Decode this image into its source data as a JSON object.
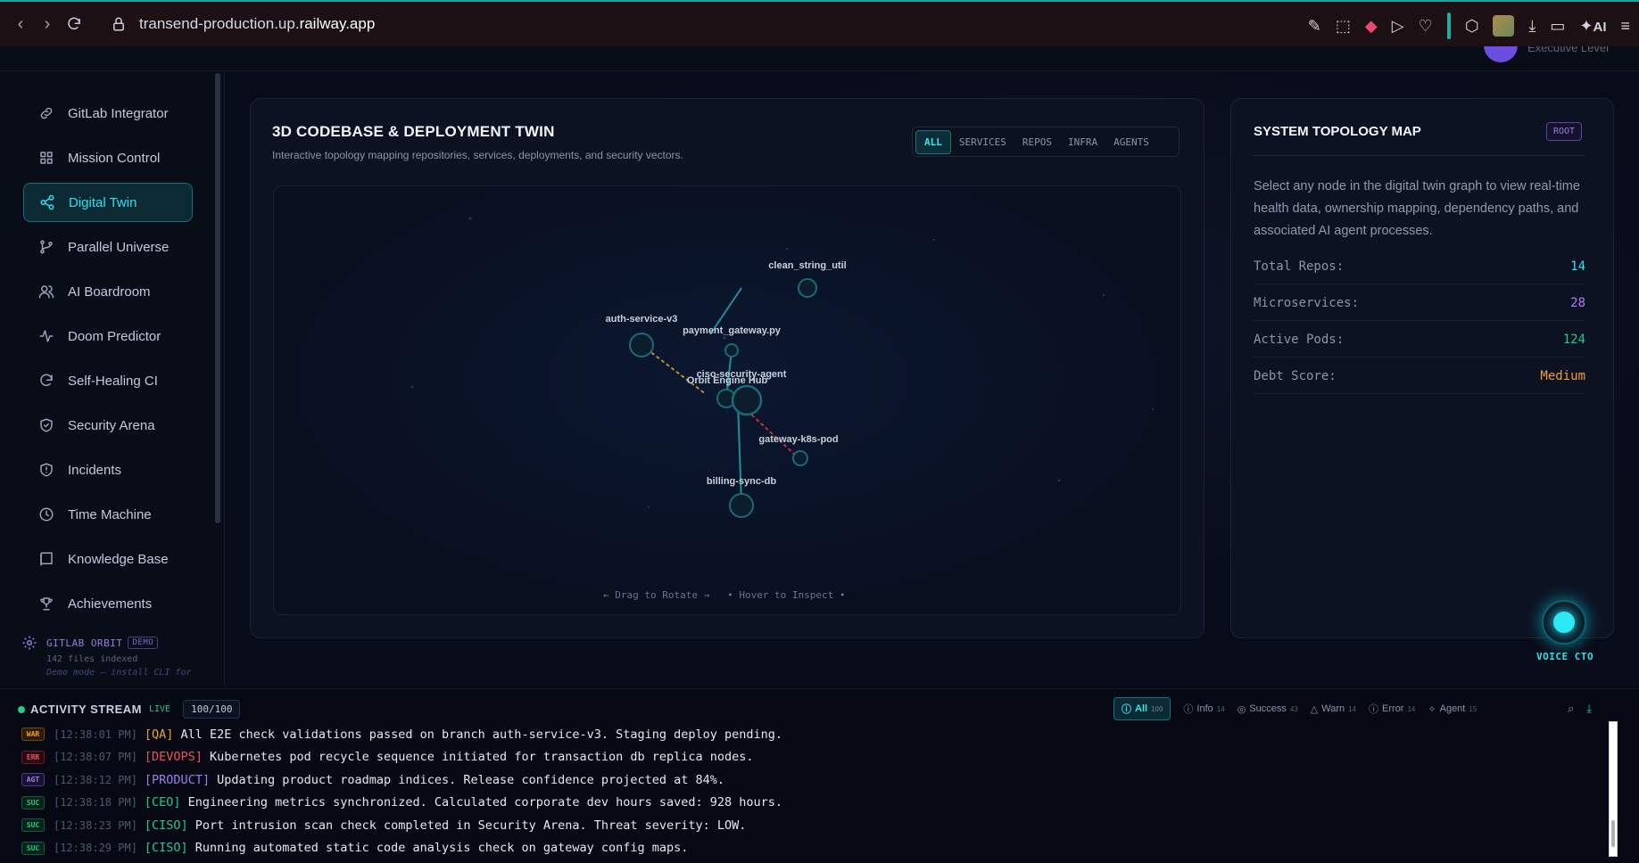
{
  "browser": {
    "url_host": "transend-production.up.",
    "url_domain": "railway.app",
    "ai_label": "AI"
  },
  "header": {
    "user_level": "Executive Level"
  },
  "sidebar": {
    "items": [
      {
        "label": "GitLab Integrator",
        "icon": "link-icon"
      },
      {
        "label": "Mission Control",
        "icon": "grid-icon"
      },
      {
        "label": "Digital Twin",
        "icon": "share-icon"
      },
      {
        "label": "Parallel Universe",
        "icon": "branch-icon"
      },
      {
        "label": "AI Boardroom",
        "icon": "users-icon"
      },
      {
        "label": "Doom Predictor",
        "icon": "pulse-icon"
      },
      {
        "label": "Self-Healing CI",
        "icon": "refresh-icon"
      },
      {
        "label": "Security Arena",
        "icon": "shield-check-icon"
      },
      {
        "label": "Incidents",
        "icon": "shield-alert-icon"
      },
      {
        "label": "Time Machine",
        "icon": "clock-icon"
      },
      {
        "label": "Knowledge Base",
        "icon": "book-icon"
      },
      {
        "label": "Achievements",
        "icon": "trophy-icon"
      }
    ],
    "active_index": 2,
    "orbit": {
      "title": "GITLAB ORBIT",
      "badge": "DEMO",
      "files": "142 files indexed",
      "note": "Demo mode — install CLI for"
    }
  },
  "twin": {
    "title": "3D CODEBASE & DEPLOYMENT TWIN",
    "subtitle": "Interactive topology mapping repositories, services, deployments, and security vectors.",
    "tabs": [
      "ALL",
      "SERVICES",
      "REPOS",
      "INFRA",
      "AGENTS"
    ],
    "active_tab": 0,
    "hint": "← Drag to Rotate →   • Hover to Inspect •",
    "nodes": [
      "clean_string_util",
      "auth-service-v3",
      "payment_gateway.py",
      "ciso-security-agent",
      "Orbit Engine Hub",
      "gateway-k8s-pod",
      "billing-sync-db"
    ]
  },
  "topology": {
    "title": "SYSTEM TOPOLOGY MAP",
    "badge": "ROOT",
    "description": "Select any node in the digital twin graph to view real-time health data, ownership mapping, dependency paths, and associated AI agent processes.",
    "stats": [
      {
        "label": "Total Repos:",
        "value": "14",
        "color": "#2fe0ec"
      },
      {
        "label": "Microservices:",
        "value": "28",
        "color": "#b07cf5"
      },
      {
        "label": "Active Pods:",
        "value": "124",
        "color": "#22c98a"
      },
      {
        "label": "Debt Score:",
        "value": "Medium",
        "color": "#f0a030"
      }
    ]
  },
  "voice": {
    "label": "VOICE CTO"
  },
  "activity": {
    "title": "ACTIVITY STREAM",
    "live": "LIVE",
    "count": "100/100",
    "filters": [
      {
        "label": "All",
        "count": "100"
      },
      {
        "label": "Info",
        "count": "14"
      },
      {
        "label": "Success",
        "count": "43"
      },
      {
        "label": "Warn",
        "count": "14"
      },
      {
        "label": "Error",
        "count": "14"
      },
      {
        "label": "Agent",
        "count": "15"
      }
    ],
    "logs": [
      {
        "level": "WAR",
        "cls": "war",
        "time": "[12:38:01 PM]",
        "agent": "[QA]",
        "color": "#f0a030",
        "msg": "All E2E check validations passed on branch auth-service-v3. Staging deploy pending."
      },
      {
        "level": "ERR",
        "cls": "err",
        "time": "[12:38:07 PM]",
        "agent": "[DEVOPS]",
        "color": "#f05060",
        "msg": "Kubernetes pod recycle sequence initiated for transaction db replica nodes."
      },
      {
        "level": "AGT",
        "cls": "agt",
        "time": "[12:38:12 PM]",
        "agent": "[PRODUCT]",
        "color": "#a07ef0",
        "msg": "Updating product roadmap indices. Release confidence projected at 84%."
      },
      {
        "level": "SUC",
        "cls": "suc",
        "time": "[12:38:18 PM]",
        "agent": "[CEO]",
        "color": "#22c98a",
        "msg": "Engineering metrics synchronized. Calculated corporate dev hours saved: 928 hours."
      },
      {
        "level": "SUC",
        "cls": "suc",
        "time": "[12:38:23 PM]",
        "agent": "[CISO]",
        "color": "#22c98a",
        "msg": "Port intrusion scan check completed in Security Arena. Threat severity: LOW."
      },
      {
        "level": "SUC",
        "cls": "suc",
        "time": "[12:38:29 PM]",
        "agent": "[CISO]",
        "color": "#22c98a",
        "msg": "Running automated static code analysis check on gateway config maps."
      }
    ]
  }
}
